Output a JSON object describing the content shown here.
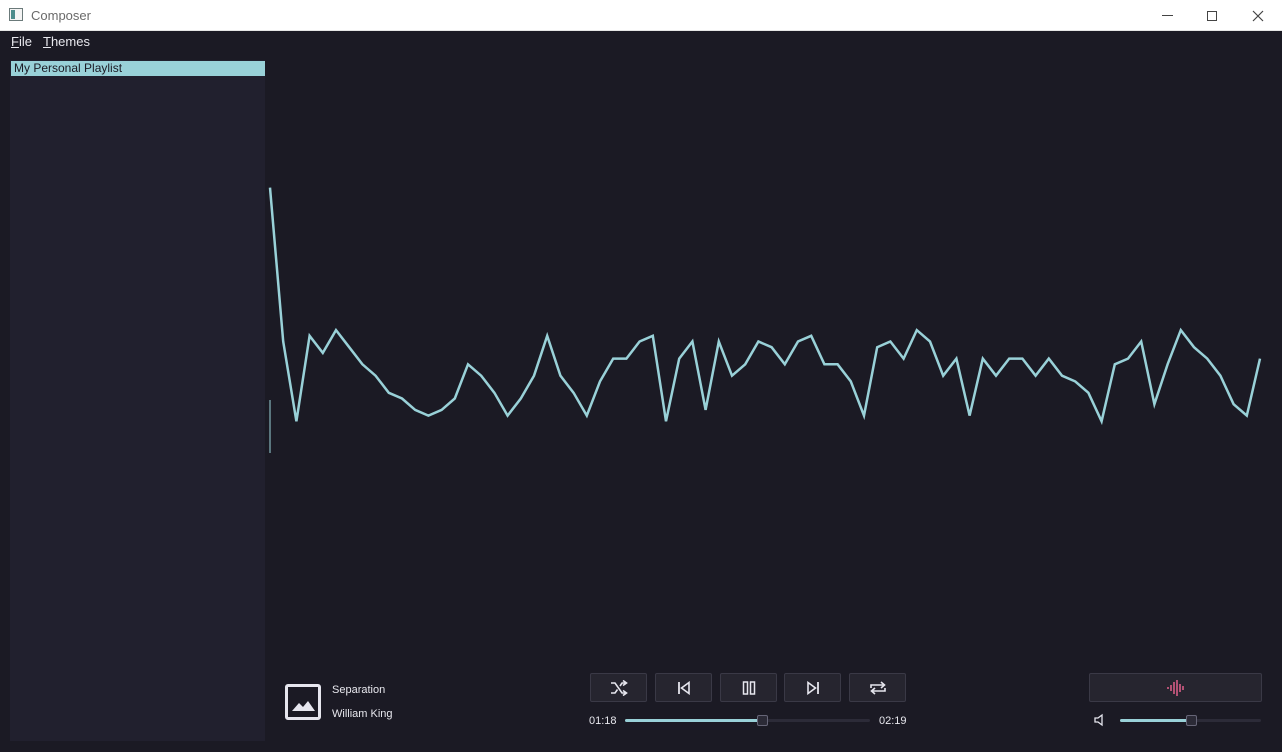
{
  "window": {
    "title": "Composer",
    "icon": "app-window-icon"
  },
  "menubar": {
    "file": {
      "accel": "F",
      "rest": "ile"
    },
    "themes": {
      "accel": "T",
      "rest": "hemes"
    }
  },
  "sidebar": {
    "playlists": [
      "My Personal Playlist"
    ],
    "selected_index": 0
  },
  "visualizer": {
    "style": "line-waveform",
    "color": "#99d1d8",
    "levels": [
      0.82,
      0.55,
      0.41,
      0.56,
      0.53,
      0.57,
      0.54,
      0.51,
      0.49,
      0.46,
      0.45,
      0.43,
      0.42,
      0.43,
      0.45,
      0.51,
      0.49,
      0.46,
      0.42,
      0.45,
      0.49,
      0.56,
      0.49,
      0.46,
      0.42,
      0.48,
      0.52,
      0.52,
      0.55,
      0.56,
      0.41,
      0.52,
      0.55,
      0.43,
      0.55,
      0.49,
      0.51,
      0.55,
      0.54,
      0.51,
      0.55,
      0.56,
      0.51,
      0.51,
      0.48,
      0.42,
      0.54,
      0.55,
      0.52,
      0.57,
      0.55,
      0.49,
      0.52,
      0.42,
      0.52,
      0.49,
      0.52,
      0.52,
      0.49,
      0.52,
      0.49,
      0.48,
      0.46,
      0.41,
      0.51,
      0.52,
      0.55,
      0.44,
      0.51,
      0.57,
      0.54,
      0.52,
      0.49,
      0.44,
      0.42,
      0.52
    ]
  },
  "now_playing": {
    "title": "Separation",
    "artist": "William King",
    "artwork_icon": "image-placeholder-icon"
  },
  "playback": {
    "current_time": "01:18",
    "total_time": "02:19",
    "progress_fraction": 0.56,
    "accent_color": "#99d1d8",
    "buttons": [
      "shuffle-icon",
      "previous-track-icon",
      "pause-icon",
      "next-track-icon",
      "repeat-icon"
    ]
  },
  "visualizer_toggle": {
    "icon": "audio-wave-icon",
    "color": "#e0608c"
  },
  "volume": {
    "icon": "speaker-icon",
    "level_fraction": 0.5
  }
}
